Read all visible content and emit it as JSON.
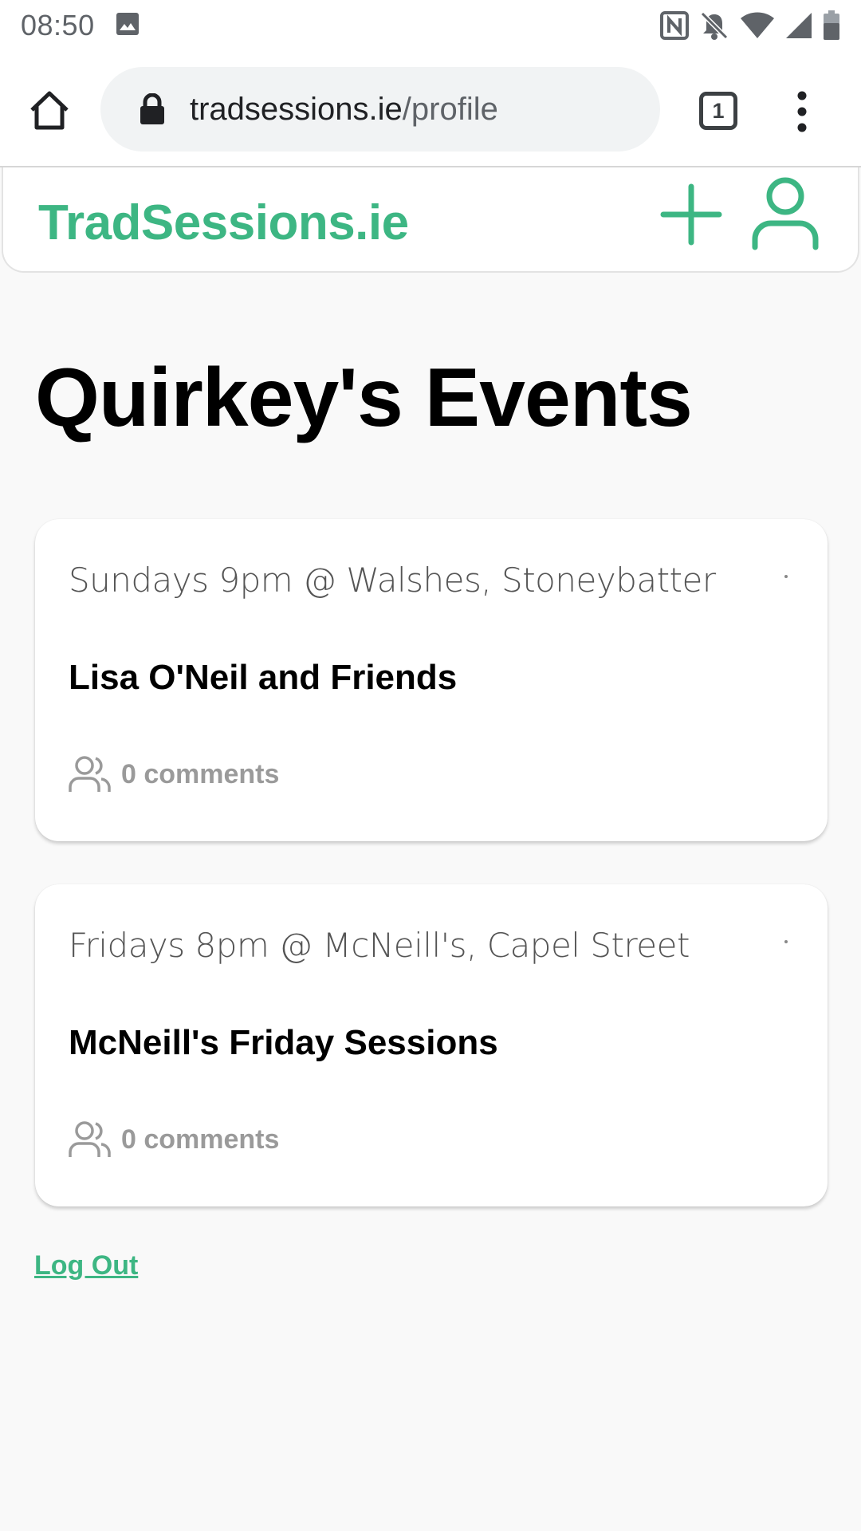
{
  "status_bar": {
    "time": "08:50",
    "icons": [
      "image-notification-icon",
      "nfc-icon",
      "bell-off-icon",
      "wifi-icon",
      "cell-signal-icon",
      "battery-icon"
    ]
  },
  "browser": {
    "url_host": "tradsessions.ie",
    "url_path": "/profile",
    "tab_count": "1",
    "icons": [
      "home-icon",
      "lock-icon",
      "tabs-icon",
      "more-vert-icon"
    ]
  },
  "site": {
    "brand": "TradSessions.ie",
    "accent_color": "#3db683",
    "icons": [
      "plus-icon",
      "user-icon"
    ]
  },
  "page": {
    "title": "Quirkey's Events",
    "events": [
      {
        "when": "Sundays 9pm @ Walshes, Stoneybatter",
        "title": "Lisa O'Neil and Friends",
        "comments": "0 comments"
      },
      {
        "when": "Fridays 8pm @ McNeill's, Capel Street",
        "title": "McNeill's Friday Sessions",
        "comments": "0 comments"
      }
    ],
    "logout_label": "Log Out"
  }
}
